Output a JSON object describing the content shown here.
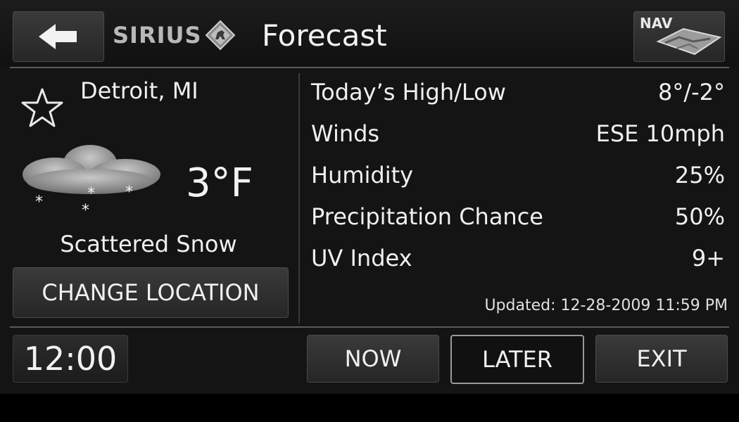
{
  "header": {
    "back_icon": "left-arrow-icon",
    "brand": "SIRIUS",
    "brand_icon": "sirius-dog-logo",
    "title": "Forecast",
    "nav_label": "NAV",
    "nav_icon": "map-icon"
  },
  "current": {
    "favorite_icon": "star-outline-icon",
    "location": "Detroit, MI",
    "weather_icon": "scattered-snow-icon",
    "temperature": "3°F",
    "condition": "Scattered Snow",
    "change_location_label": "CHANGE LOCATION"
  },
  "details": [
    {
      "label": "Today’s High/Low",
      "value": "8°/-2°"
    },
    {
      "label": "Winds",
      "value": "ESE 10mph"
    },
    {
      "label": "Humidity",
      "value": "25%"
    },
    {
      "label": "Precipitation Chance",
      "value": "50%"
    },
    {
      "label": "UV Index",
      "value": "9+"
    }
  ],
  "updated": "Updated: 12-28-2009 11:59 PM",
  "footer": {
    "clock": "12:00",
    "tabs": [
      {
        "label": "NOW",
        "active": false
      },
      {
        "label": "LATER",
        "active": true
      }
    ],
    "exit_label": "EXIT"
  }
}
